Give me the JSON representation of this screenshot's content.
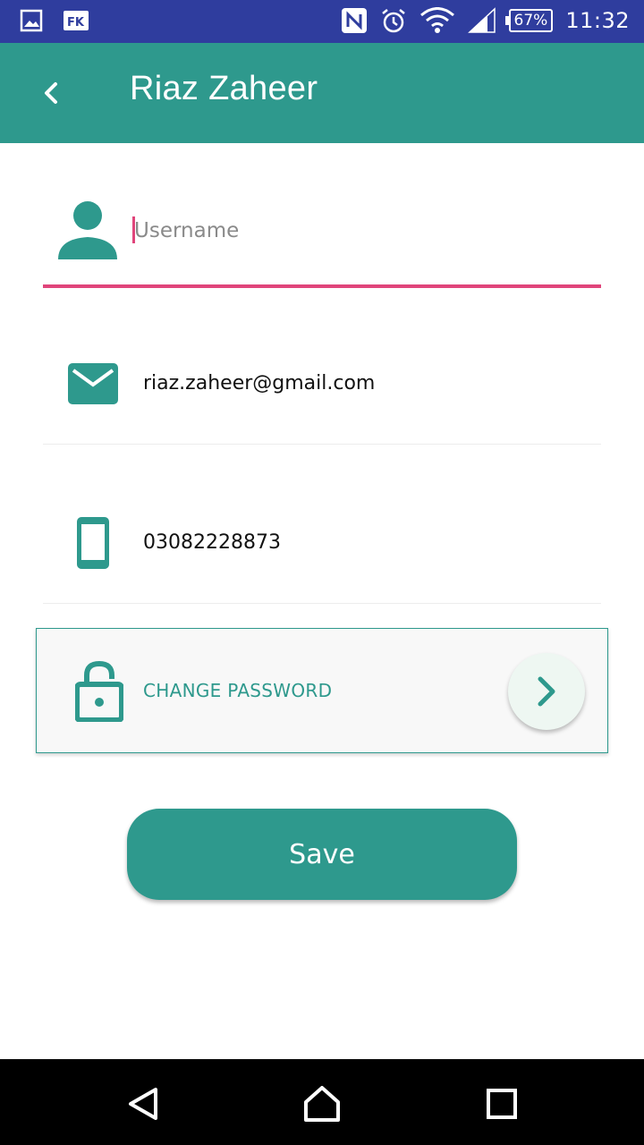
{
  "status_bar": {
    "left_icons": [
      "gallery-icon",
      "flipkart-icon"
    ],
    "right_icons": [
      "nfc-icon",
      "alarm-icon",
      "wifi-icon",
      "signal-icon"
    ],
    "battery": "67%",
    "time": "11:32"
  },
  "app_bar": {
    "title": "Riaz Zaheer",
    "back_icon": "back-arrow-icon"
  },
  "form": {
    "username": {
      "placeholder": "Username",
      "value": "",
      "icon": "person-icon"
    },
    "email": {
      "value": "riaz.zaheer@gmail.com",
      "icon": "mail-icon"
    },
    "phone": {
      "value": "03082228873",
      "icon": "phone-icon"
    },
    "change_password": {
      "label": "CHANGE PASSWORD",
      "icon": "lock-icon",
      "action_icon": "chevron-right-icon"
    }
  },
  "save_button": {
    "label": "Save"
  },
  "nav_bar": {
    "icons": [
      "back-triangle-icon",
      "home-icon",
      "recents-icon"
    ]
  },
  "colors": {
    "status_bar": "#2f3d9e",
    "primary": "#2e998d",
    "accent": "#e0457b",
    "card_bg": "#f8f8f8",
    "nav_bar": "#000000"
  }
}
